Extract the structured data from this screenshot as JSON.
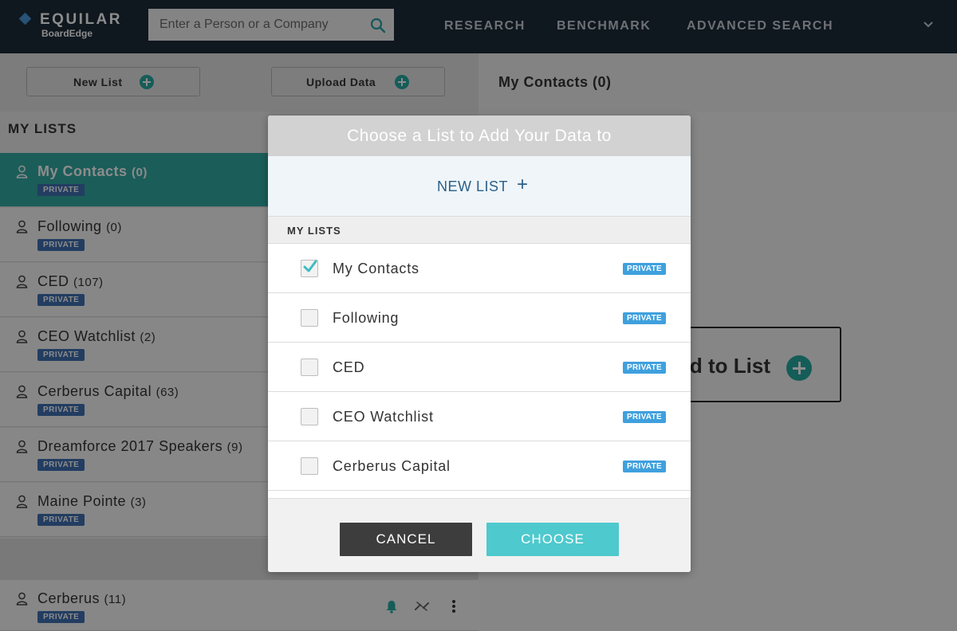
{
  "header": {
    "logo_main": "EQUILAR",
    "logo_sub": "BoardEdge",
    "search_placeholder": "Enter a Person or a Company",
    "nav": [
      "RESEARCH",
      "BENCHMARK",
      "ADVANCED SEARCH"
    ]
  },
  "actions": {
    "new_list": "New List",
    "upload_data": "Upload Data"
  },
  "sidebar": {
    "title": "MY LISTS",
    "items": [
      {
        "name": "My Contacts",
        "count": "(0)",
        "badge": "PRIVATE"
      },
      {
        "name": "Following",
        "count": "(0)",
        "badge": "PRIVATE"
      },
      {
        "name": "CED",
        "count": "(107)",
        "badge": "PRIVATE"
      },
      {
        "name": "CEO Watchlist",
        "count": "(2)",
        "badge": "PRIVATE"
      },
      {
        "name": "Cerberus Capital",
        "count": "(63)",
        "badge": "PRIVATE"
      },
      {
        "name": "Dreamforce 2017 Speakers",
        "count": "(9)",
        "badge": "PRIVATE"
      },
      {
        "name": "Maine Pointe",
        "count": "(3)",
        "badge": "PRIVATE"
      }
    ],
    "bottom_item": {
      "name": "Cerberus",
      "count": "(11)",
      "badge": "PRIVATE"
    }
  },
  "right_panel": {
    "title": "My Contacts (0)",
    "add_to_list": "Add to List"
  },
  "modal": {
    "title": "Choose a List to Add Your Data to",
    "new_list": "NEW LIST",
    "new_list_plus": "+",
    "section": "MY LISTS",
    "options": [
      {
        "label": "My Contacts",
        "badge": "PRIVATE",
        "checked": true
      },
      {
        "label": "Following",
        "badge": "PRIVATE",
        "checked": false
      },
      {
        "label": "CED",
        "badge": "PRIVATE",
        "checked": false
      },
      {
        "label": "CEO Watchlist",
        "badge": "PRIVATE",
        "checked": false
      },
      {
        "label": "Cerberus Capital",
        "badge": "PRIVATE",
        "checked": false
      }
    ],
    "cancel": "CANCEL",
    "choose": "CHOOSE"
  },
  "colors": {
    "header_bg": "#1d2b39",
    "accent_teal": "#32a9a3",
    "choose_teal": "#4ec9cd",
    "badge_blue": "#3f6fb1",
    "option_badge_blue": "#3fa0dd"
  }
}
